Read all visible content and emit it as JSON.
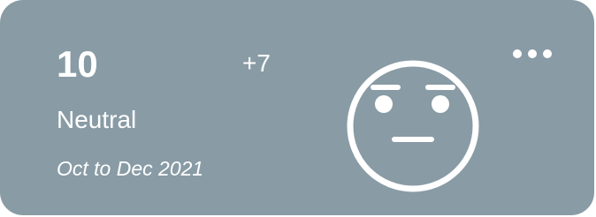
{
  "card": {
    "count": "10",
    "delta": "+7",
    "mood_label": "Neutral",
    "period": "Oct to Dec 2021",
    "icon": "neutral-face-icon",
    "menu_icon": "more-horizontal-icon",
    "colors": {
      "background": "#899ca6",
      "foreground": "#ffffff"
    }
  }
}
